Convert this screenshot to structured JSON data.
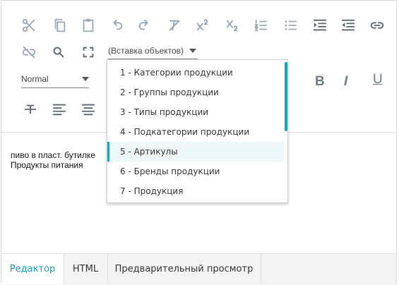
{
  "toolbar": {
    "insert_label": "(Вставка объектов)",
    "style_label": "Normal",
    "bold_label": "B",
    "italic_label": "I",
    "underline_label": "U"
  },
  "dropdown": {
    "items": [
      "1 - Категории продукции",
      "2 - Группы продукции",
      "3 - Типы продукции",
      "4 - Подкатегории продукции",
      "5 - Артикулы",
      "6 - Бренды продукции",
      "7 - Продукция"
    ],
    "selected_index": 4,
    "accent_color": "#1aa3b8"
  },
  "content": {
    "lines": [
      "пиво в пласт. бутилке",
      "Продукты питания"
    ]
  },
  "tabs": [
    "Редактор",
    "HTML",
    "Предварительный просмотр"
  ],
  "colors": {
    "accent": "#1a9bb0",
    "icon": "#9aa7b2"
  }
}
